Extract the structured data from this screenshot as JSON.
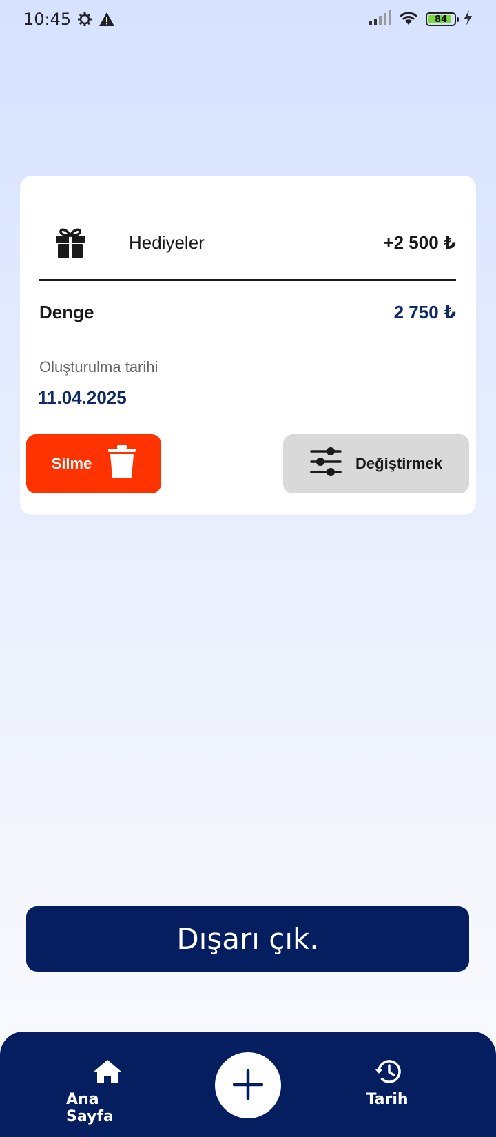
{
  "status_bar": {
    "time": "10:45",
    "battery": "84",
    "icons": [
      "settings-icon",
      "warning-icon",
      "signal-icon",
      "wifi-icon",
      "battery-icon",
      "charging-icon"
    ]
  },
  "transaction": {
    "category_icon": "gift-icon",
    "category": "Hediyeler",
    "amount": "+2 500 ₺",
    "balance_label": "Denge",
    "balance_value": "2 750 ₺",
    "created_label": "Oluşturulma tarihi",
    "created_date": "11.04.2025"
  },
  "actions": {
    "delete_label": "Silme",
    "delete_icon": "trash-icon",
    "edit_label": "Değiştirmek",
    "edit_icon": "sliders-icon"
  },
  "logout_label": "Dışarı çık.",
  "nav": {
    "home_label": "Ana Sayfa",
    "home_icon": "home-icon",
    "add_icon": "plus-icon",
    "history_label": "Tarih",
    "history_icon": "history-icon"
  },
  "colors": {
    "primary": "#041e5f",
    "delete": "#ff3300",
    "edit": "#d9d9d9",
    "accent_text": "#0e2a66"
  }
}
